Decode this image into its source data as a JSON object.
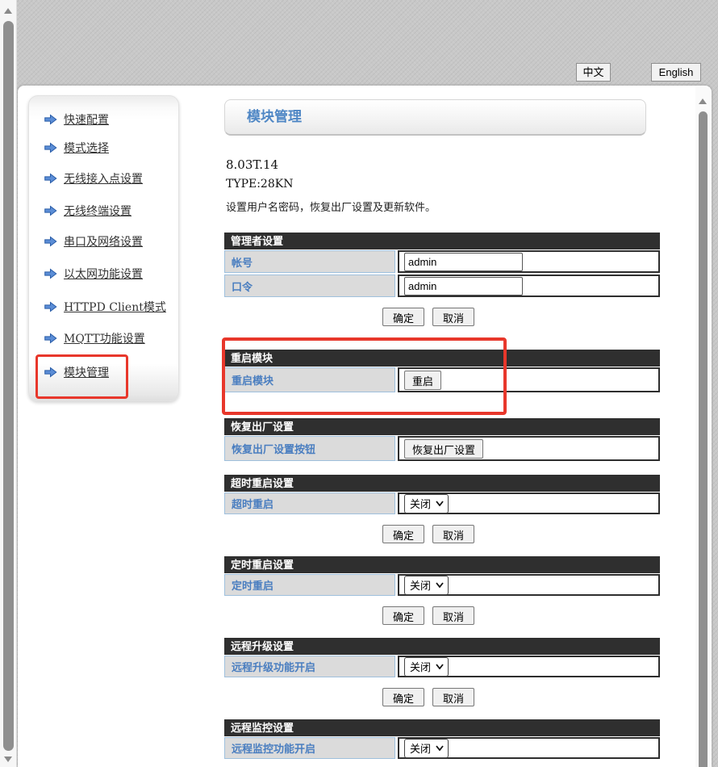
{
  "language_bar": {
    "chinese": "中文",
    "english": "English"
  },
  "sidebar": {
    "items": [
      {
        "label": "快速配置"
      },
      {
        "label": "模式选择"
      },
      {
        "label": "无线接入点设置"
      },
      {
        "label": "无线终端设置"
      },
      {
        "label": "串口及网络设置"
      },
      {
        "label": "以太网功能设置"
      },
      {
        "label": "HTTPD Client模式"
      },
      {
        "label": "MQTT功能设置"
      },
      {
        "label": "模块管理"
      }
    ],
    "highlighted_item": "模块管理"
  },
  "page": {
    "title": "模块管理",
    "version": "8.03T.14",
    "type_line": "TYPE:28KN",
    "description": "设置用户名密码，恢复出厂设置及更新软件。"
  },
  "sections": [
    {
      "title": "管理者设置",
      "rows": [
        {
          "label": "帐号",
          "control": {
            "type": "text",
            "value": "admin",
            "name": "username-input"
          }
        },
        {
          "label": "口令",
          "control": {
            "type": "text",
            "value": "admin",
            "name": "password-input"
          }
        }
      ],
      "buttons": [
        {
          "label": "确定",
          "name": "ok-button"
        },
        {
          "label": "取消",
          "name": "cancel-button"
        }
      ]
    },
    {
      "title": "重启模块",
      "rows": [
        {
          "label": "重启模块",
          "control": {
            "type": "button",
            "label": "重启",
            "name": "restart-button"
          }
        }
      ],
      "buttons": []
    },
    {
      "title": "恢复出厂设置",
      "rows": [
        {
          "label": "恢复出厂设置按钮",
          "control": {
            "type": "button",
            "label": "恢复出厂设置",
            "name": "factory-reset-button"
          }
        }
      ],
      "buttons": []
    },
    {
      "title": "超时重启设置",
      "rows": [
        {
          "label": "超时重启",
          "control": {
            "type": "select",
            "value": "关闭",
            "name": "timeout-restart-select"
          }
        }
      ],
      "buttons": [
        {
          "label": "确定",
          "name": "ok-button"
        },
        {
          "label": "取消",
          "name": "cancel-button"
        }
      ]
    },
    {
      "title": "定时重启设置",
      "rows": [
        {
          "label": "定时重启",
          "control": {
            "type": "select",
            "value": "关闭",
            "name": "scheduled-restart-select"
          }
        }
      ],
      "buttons": [
        {
          "label": "确定",
          "name": "ok-button"
        },
        {
          "label": "取消",
          "name": "cancel-button"
        }
      ]
    },
    {
      "title": "远程升级设置",
      "rows": [
        {
          "label": "远程升级功能开启",
          "control": {
            "type": "select",
            "value": "关闭",
            "name": "remote-upgrade-select"
          }
        }
      ],
      "buttons": [
        {
          "label": "确定",
          "name": "ok-button"
        },
        {
          "label": "取消",
          "name": "cancel-button"
        }
      ]
    },
    {
      "title": "远程监控设置",
      "rows": [
        {
          "label": "远程监控功能开启",
          "control": {
            "type": "select",
            "value": "关闭",
            "name": "remote-monitor-select"
          }
        }
      ],
      "buttons": []
    }
  ],
  "colors": {
    "title_blue": "#4F87C5",
    "label_blue": "#4A7EC0",
    "section_header_bg": "#2F2F2F",
    "label_cell_bg": "#DBDBDB",
    "label_cell_border": "#9FC0DD",
    "annotation_red": "#E8372B",
    "arrow_icon_blue": "#5B8DD6"
  }
}
